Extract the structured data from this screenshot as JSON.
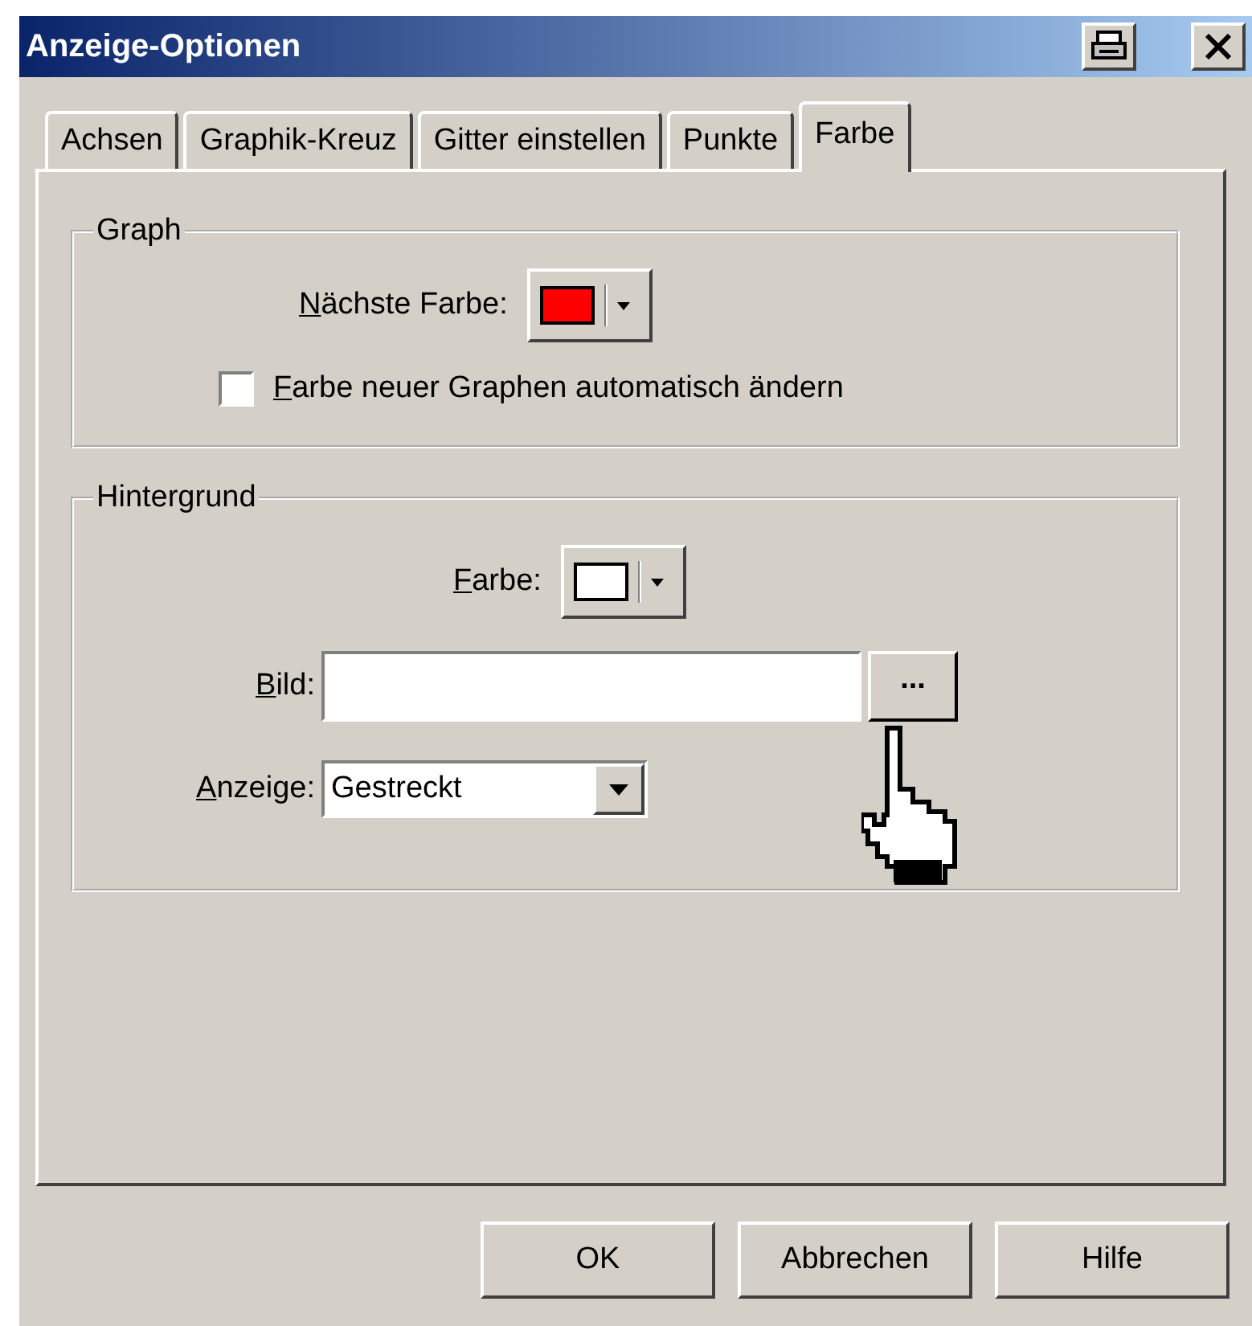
{
  "window": {
    "title": "Anzeige-Optionen"
  },
  "tabs": [
    {
      "label": "Achsen",
      "selected": false
    },
    {
      "label": "Graphik-Kreuz",
      "selected": false
    },
    {
      "label": "Gitter einstellen",
      "selected": false
    },
    {
      "label": "Punkte",
      "selected": false
    },
    {
      "label": "Farbe",
      "selected": true
    }
  ],
  "graph": {
    "legend": "Graph",
    "next_color": {
      "label": {
        "key": "N",
        "rest": "ächste Farbe:"
      },
      "color": "#ff0000"
    },
    "auto_change": {
      "label": {
        "key": "F",
        "rest": "arbe neuer Graphen automatisch ändern"
      },
      "checked": false
    }
  },
  "background": {
    "legend": "Hintergrund",
    "color": {
      "label": {
        "key": "F",
        "rest": "arbe:"
      },
      "color": "#ffffff"
    },
    "image": {
      "label": {
        "key": "B",
        "rest": "ild:"
      },
      "browse": "..."
    },
    "display": {
      "label": {
        "key": "A",
        "rest": "nzeige:"
      },
      "value": "Gestreckt"
    }
  },
  "buttons": [
    "OK",
    "Abbrechen",
    "Hilfe"
  ]
}
